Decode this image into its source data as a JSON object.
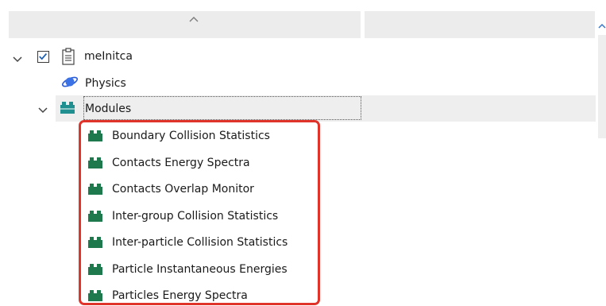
{
  "tree": {
    "root": {
      "label": "meInitca",
      "checked": true
    },
    "physics": {
      "label": "Physics"
    },
    "modules": {
      "label": "Modules",
      "items": [
        {
          "label": "Boundary Collision Statistics"
        },
        {
          "label": "Contacts Energy Spectra"
        },
        {
          "label": "Contacts Overlap Monitor"
        },
        {
          "label": "Inter-group Collision Statistics"
        },
        {
          "label": "Inter-particle Collision Statistics"
        },
        {
          "label": "Particle Instantaneous Energies"
        },
        {
          "label": "Particles Energy Spectra"
        }
      ]
    }
  },
  "colors": {
    "module_icon": "#1e7a4c",
    "modules_icon": "#1f8f8f",
    "highlight_border": "#e0342b",
    "physics_icon": "#2a5bd7"
  },
  "icons": {
    "sort": "caret-up-icon",
    "expand": "chevron-down-icon",
    "root": "clipboard-icon",
    "physics": "planet-icon",
    "module": "puzzle-block-icon"
  }
}
